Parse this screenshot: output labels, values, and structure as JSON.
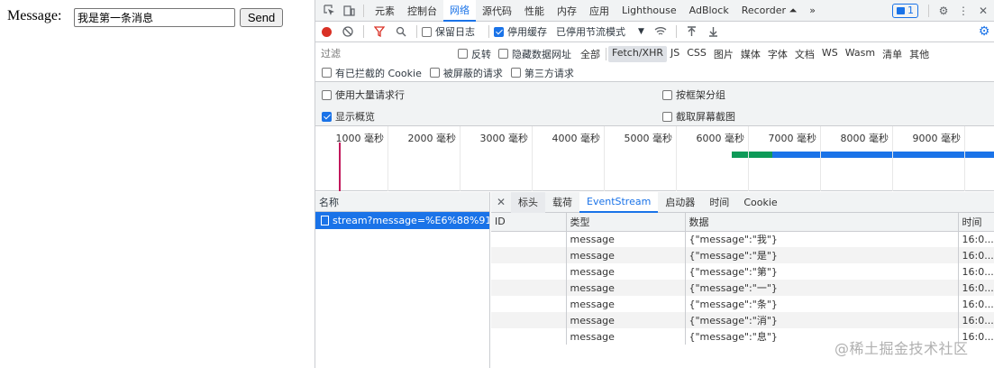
{
  "page": {
    "label": "Message:",
    "input_value": "我是第一条消息",
    "send_label": "Send"
  },
  "devtools": {
    "tabs": [
      "元素",
      "控制台",
      "网络",
      "源代码",
      "性能",
      "内存",
      "应用",
      "Lighthouse",
      "AdBlock",
      "Recorder ⏶",
      "»"
    ],
    "active_tab": "网络",
    "message_badge": "1",
    "toolbar": {
      "preserve_log": "保留日志",
      "disable_cache": "停用缓存",
      "throttle": "已停用节流模式"
    },
    "filter": {
      "placeholder": "过滤",
      "invert": "反转",
      "hide_data_urls": "隐藏数据网址",
      "all": "全部",
      "types": [
        "Fetch/XHR",
        "JS",
        "CSS",
        "图片",
        "媒体",
        "字体",
        "文档",
        "WS",
        "Wasm",
        "清单",
        "其他"
      ],
      "active_type": "Fetch/XHR",
      "blocked_cookies": "有已拦截的 Cookie",
      "blocked_requests": "被屏蔽的请求",
      "third_party": "第三方请求"
    },
    "options": {
      "large_rows": "使用大量请求行",
      "group_by_frame": "按框架分组",
      "show_overview": "显示概览",
      "capture_screenshots": "截取屏幕截图"
    },
    "overview": {
      "ticks": [
        "1000 毫秒",
        "2000 毫秒",
        "3000 毫秒",
        "4000 毫秒",
        "5000 毫秒",
        "6000 毫秒",
        "7000 毫秒",
        "8000 毫秒",
        "9000 毫秒",
        "1"
      ]
    },
    "names": {
      "header": "名称",
      "request": "stream?message=%E6%88%91%..."
    },
    "detail": {
      "tabs": [
        "标头",
        "载荷",
        "EventStream",
        "启动器",
        "时间",
        "Cookie"
      ],
      "active_tab": "EventStream",
      "columns": [
        "ID",
        "类型",
        "数据",
        "时间"
      ],
      "rows": [
        {
          "id": "",
          "type": "message",
          "data": "{\"message\":\"我\"}",
          "time": "16:0..."
        },
        {
          "id": "",
          "type": "message",
          "data": "{\"message\":\"是\"}",
          "time": "16:0..."
        },
        {
          "id": "",
          "type": "message",
          "data": "{\"message\":\"第\"}",
          "time": "16:0..."
        },
        {
          "id": "",
          "type": "message",
          "data": "{\"message\":\"一\"}",
          "time": "16:0..."
        },
        {
          "id": "",
          "type": "message",
          "data": "{\"message\":\"条\"}",
          "time": "16:0..."
        },
        {
          "id": "",
          "type": "message",
          "data": "{\"message\":\"消\"}",
          "time": "16:0..."
        },
        {
          "id": "",
          "type": "message",
          "data": "{\"message\":\"息\"}",
          "time": "16:0..."
        }
      ]
    }
  },
  "watermark": "@稀土掘金技术社区"
}
